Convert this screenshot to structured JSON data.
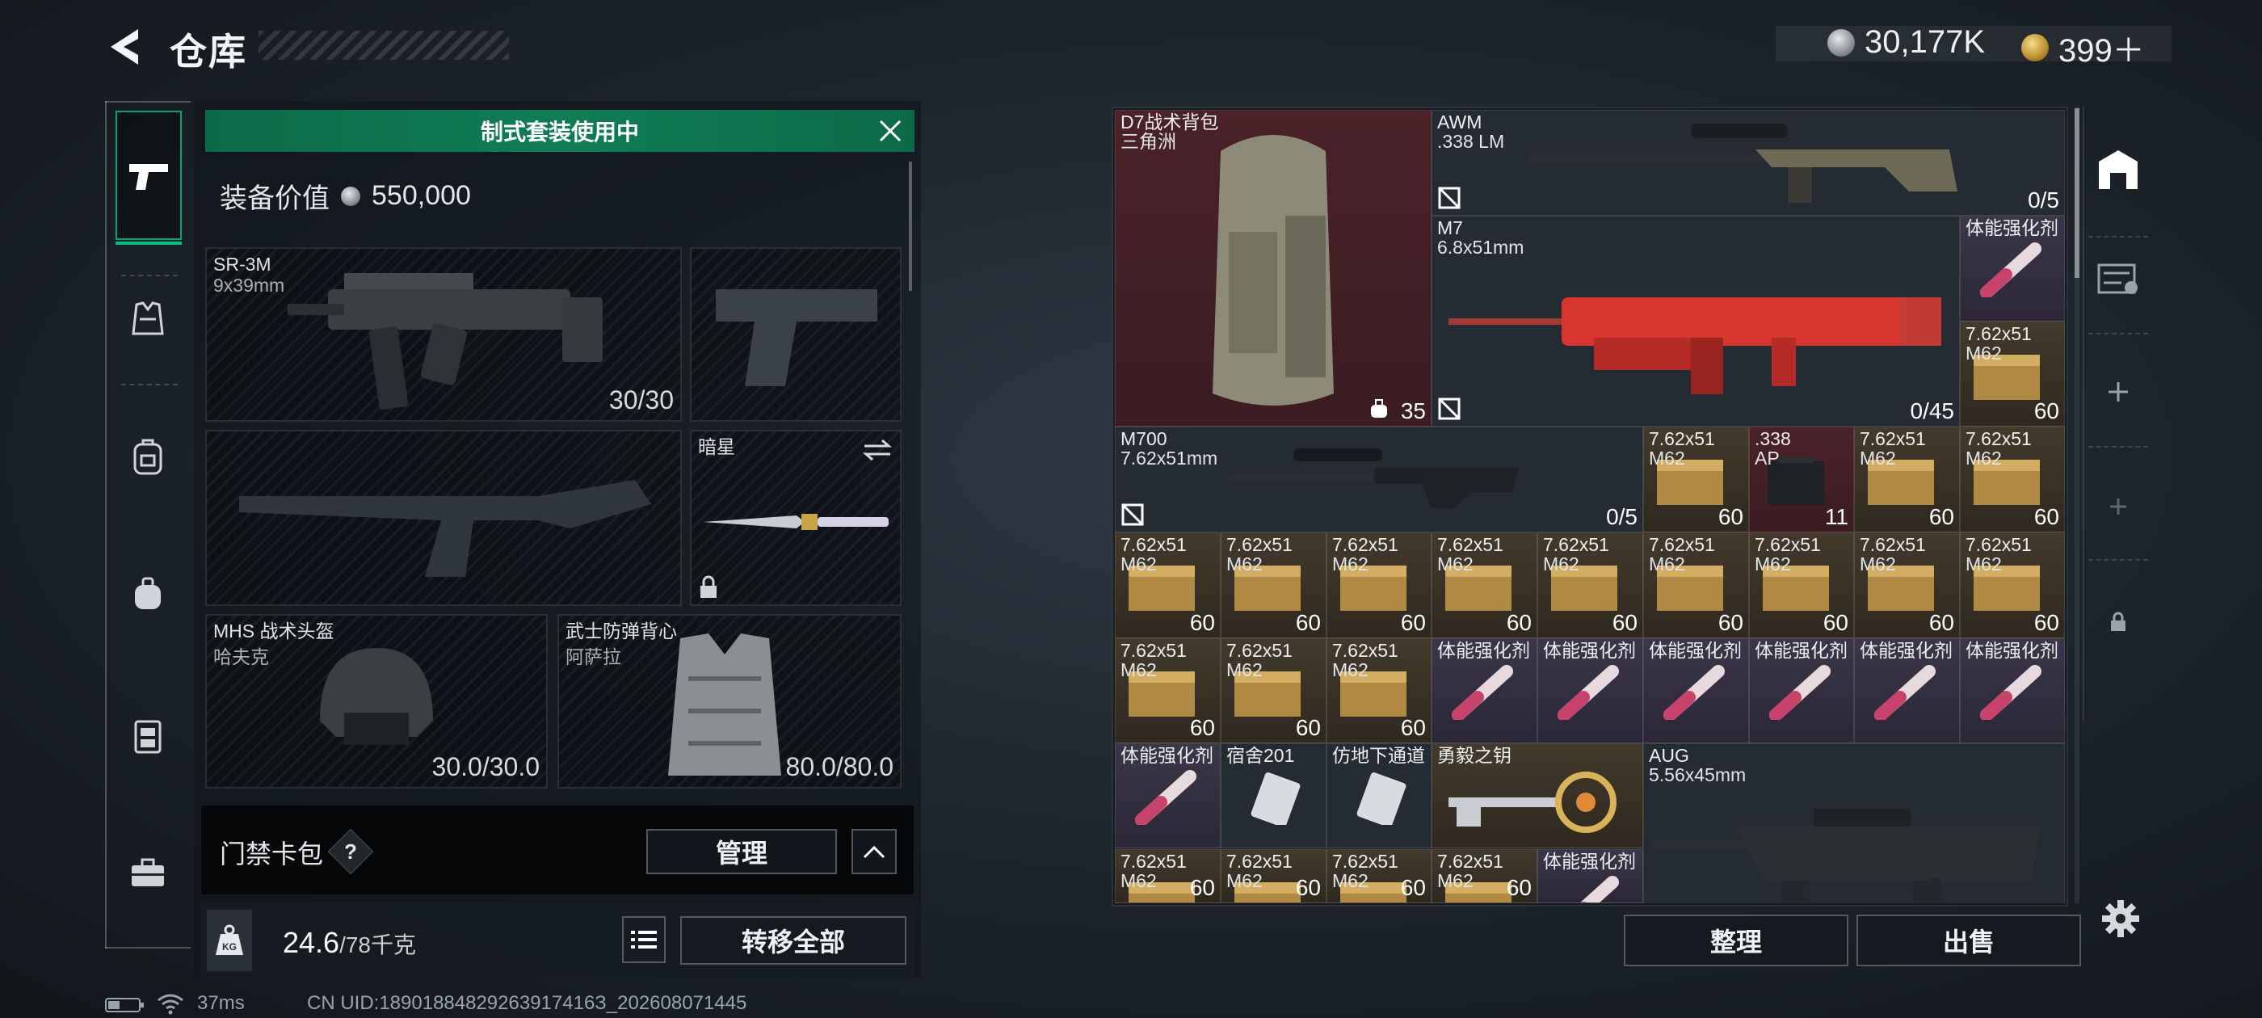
{
  "header": {
    "title": "仓库"
  },
  "currency": {
    "coins": "30,177K",
    "tickets": "399＋"
  },
  "loadout": {
    "banner": "制式套装使用中",
    "equip_value_label": "装备价值",
    "equip_value": "550,000",
    "primary": {
      "name": "SR-3M",
      "caliber": "9x39mm",
      "ammo": "30/30"
    },
    "melee": {
      "name": "暗星"
    },
    "helmet": {
      "name": "MHS 战术头盔",
      "sub": "哈夫克",
      "durability": "30.0/30.0"
    },
    "armor": {
      "name": "武士防弹背心",
      "sub": "阿萨拉",
      "durability": "80.0/80.0"
    },
    "access_card": "门禁卡包",
    "question": "?",
    "manage_button": "管理",
    "weight": "24.6",
    "weight_max": "/78千克",
    "transfer_all": "转移全部"
  },
  "storage": {
    "backpack": {
      "name": "D7战术背包",
      "sub": "三角洲",
      "count": "35"
    },
    "awm": {
      "name": "AWM",
      "caliber": ".338 LM",
      "ammo": "0/5"
    },
    "m7": {
      "name": "M7",
      "caliber": "6.8x51mm",
      "ammo": "0/45"
    },
    "m700": {
      "name": "M700",
      "caliber": "7.62x51mm",
      "ammo": "0/5"
    },
    "aug": {
      "name": "AUG",
      "caliber": "5.56x45mm"
    },
    "ammo_name": "7.62x51",
    "ammo_sub": "M62",
    "ammo_count": "60",
    "ap_name": ".338",
    "ap_sub": "AP",
    "ap_count": "11",
    "stim_name": "体能强化剂",
    "key1": "宿舍201",
    "key2": "仿地下通道",
    "key3": "勇毅之钥",
    "sort_button": "整理",
    "sell_button": "出售"
  },
  "status": {
    "ping": "37ms",
    "uid": "CN UID:18901884829263917416З_202608071445"
  }
}
